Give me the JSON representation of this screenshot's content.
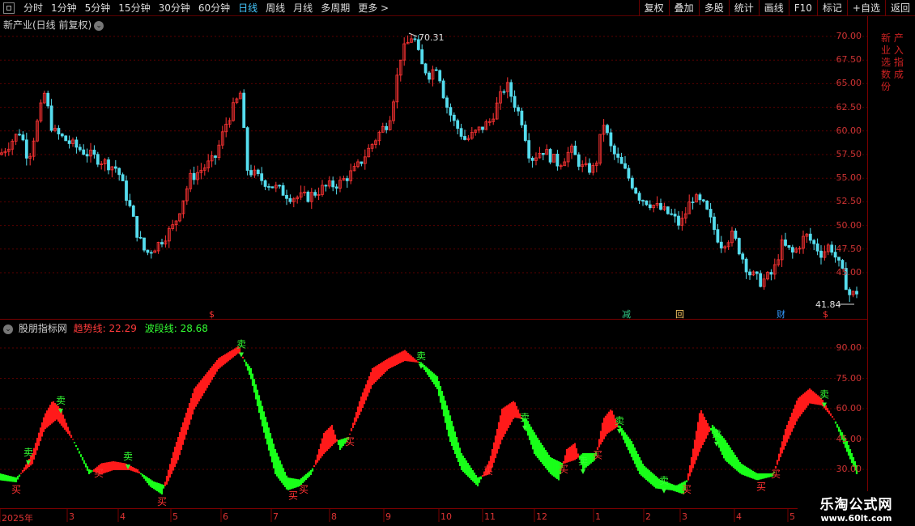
{
  "toolbar": {
    "periods": [
      "分时",
      "1分钟",
      "5分钟",
      "15分钟",
      "30分钟",
      "60分钟",
      "日线",
      "周线",
      "月线",
      "多周期",
      "更多 >"
    ],
    "active_period": "日线",
    "tools": [
      "复权",
      "叠加",
      "多股",
      "统计",
      "画线",
      "F10",
      "标记",
      "+自选",
      "返回"
    ]
  },
  "main_chart": {
    "title": "新产业(日线 前复权)",
    "y_ticks": [
      "70.00",
      "67.50",
      "65.00",
      "62.50",
      "60.00",
      "57.50",
      "55.00",
      "52.50",
      "50.00",
      "47.50",
      "45.00"
    ],
    "high_label": "70.31",
    "low_label": "41.84",
    "markers": [
      {
        "text": "$",
        "color": "#ff3333",
        "x": 263
      },
      {
        "text": "减",
        "color": "#33cc88",
        "x": 773
      },
      {
        "text": "回",
        "color": "#ffcc66",
        "x": 839
      },
      {
        "text": "财",
        "color": "#3399ff",
        "x": 964
      },
      {
        "text": "$",
        "color": "#ff3333",
        "x": 1021
      }
    ],
    "right_labels": "新 产 业 入 选 指 数 成 份"
  },
  "indicator": {
    "name": "股朋指标网",
    "trend_label": "趋势线: 22.29",
    "wave_label": "波段线: 28.68",
    "y_ticks": [
      "90.00",
      "75.00",
      "60.00",
      "45.00",
      "30.00"
    ],
    "sell_label": "卖",
    "buy_label": "买"
  },
  "x_axis": {
    "labels": [
      "2025年",
      "3",
      "4",
      "5",
      "6",
      "7",
      "8",
      "9",
      "10",
      "11",
      "12",
      "1",
      "2",
      "3",
      "4",
      "5"
    ]
  },
  "watermark": {
    "line1": "乐淘公式网",
    "line2": "www.60lt.com"
  },
  "colors": {
    "up": "#ff3333",
    "down": "#55ddee",
    "trend_red": "#ff1a1a",
    "trend_green": "#19ff19",
    "grid": "#7a0000",
    "active": "#45c8ff"
  },
  "chart_data": {
    "type": "line",
    "price_anchors": [
      [
        0,
        57.5
      ],
      [
        25,
        60
      ],
      [
        35,
        57
      ],
      [
        55,
        64
      ],
      [
        65,
        60
      ],
      [
        90,
        58.5
      ],
      [
        110,
        57.5
      ],
      [
        145,
        56
      ],
      [
        160,
        52
      ],
      [
        170,
        49
      ],
      [
        180,
        47
      ],
      [
        195,
        48
      ],
      [
        215,
        50
      ],
      [
        235,
        55
      ],
      [
        265,
        57
      ],
      [
        280,
        61
      ],
      [
        297,
        64
      ],
      [
        305,
        56
      ],
      [
        320,
        55
      ],
      [
        340,
        54
      ],
      [
        360,
        53
      ],
      [
        380,
        53
      ],
      [
        400,
        54
      ],
      [
        420,
        54.5
      ],
      [
        440,
        56
      ],
      [
        455,
        58
      ],
      [
        470,
        60
      ],
      [
        480,
        61
      ],
      [
        487,
        64
      ],
      [
        495,
        68
      ],
      [
        505,
        69.5
      ],
      [
        510,
        70.3
      ],
      [
        520,
        67
      ],
      [
        530,
        66
      ],
      [
        540,
        67
      ],
      [
        550,
        63
      ],
      [
        560,
        61
      ],
      [
        575,
        59
      ],
      [
        590,
        60
      ],
      [
        605,
        61
      ],
      [
        615,
        63
      ],
      [
        625,
        65
      ],
      [
        635,
        63
      ],
      [
        645,
        61
      ],
      [
        655,
        57
      ],
      [
        670,
        58
      ],
      [
        690,
        56.5
      ],
      [
        705,
        58
      ],
      [
        720,
        56
      ],
      [
        735,
        56
      ],
      [
        745,
        61
      ],
      [
        755,
        58
      ],
      [
        770,
        56
      ],
      [
        790,
        53
      ],
      [
        810,
        52
      ],
      [
        830,
        51
      ],
      [
        840,
        50
      ],
      [
        855,
        53
      ],
      [
        870,
        52
      ],
      [
        880,
        50
      ],
      [
        890,
        48
      ],
      [
        905,
        49
      ],
      [
        915,
        47
      ],
      [
        925,
        45
      ],
      [
        940,
        44
      ],
      [
        955,
        45
      ],
      [
        965,
        48
      ],
      [
        980,
        47
      ],
      [
        995,
        49
      ],
      [
        1005,
        48
      ],
      [
        1015,
        47
      ],
      [
        1025,
        48
      ],
      [
        1040,
        45
      ],
      [
        1050,
        42.5
      ],
      [
        1058,
        43
      ]
    ],
    "trend_anchors": [
      [
        0,
        25
      ],
      [
        20,
        24
      ],
      [
        40,
        38
      ],
      [
        55,
        57
      ],
      [
        65,
        64
      ],
      [
        75,
        60
      ],
      [
        90,
        45
      ],
      [
        110,
        28
      ],
      [
        125,
        33
      ],
      [
        140,
        34
      ],
      [
        155,
        33
      ],
      [
        170,
        30
      ],
      [
        185,
        22
      ],
      [
        200,
        18
      ],
      [
        215,
        40
      ],
      [
        240,
        70
      ],
      [
        270,
        85
      ],
      [
        295,
        91
      ],
      [
        310,
        75
      ],
      [
        325,
        50
      ],
      [
        340,
        28
      ],
      [
        355,
        20
      ],
      [
        370,
        22
      ],
      [
        385,
        28
      ],
      [
        400,
        48
      ],
      [
        410,
        52
      ],
      [
        420,
        40
      ],
      [
        430,
        45
      ],
      [
        445,
        65
      ],
      [
        460,
        80
      ],
      [
        480,
        85
      ],
      [
        500,
        89
      ],
      [
        520,
        82
      ],
      [
        540,
        70
      ],
      [
        555,
        45
      ],
      [
        570,
        30
      ],
      [
        590,
        22
      ],
      [
        605,
        35
      ],
      [
        620,
        60
      ],
      [
        635,
        64
      ],
      [
        645,
        55
      ],
      [
        660,
        38
      ],
      [
        680,
        28
      ],
      [
        690,
        25
      ],
      [
        700,
        40
      ],
      [
        710,
        43
      ],
      [
        720,
        30
      ],
      [
        735,
        35
      ],
      [
        745,
        55
      ],
      [
        755,
        60
      ],
      [
        770,
        45
      ],
      [
        790,
        28
      ],
      [
        810,
        21
      ],
      [
        830,
        20
      ],
      [
        845,
        18
      ],
      [
        855,
        38
      ],
      [
        865,
        60
      ],
      [
        880,
        48
      ],
      [
        895,
        35
      ],
      [
        915,
        28
      ],
      [
        935,
        25
      ],
      [
        955,
        27
      ],
      [
        970,
        50
      ],
      [
        985,
        65
      ],
      [
        1000,
        70
      ],
      [
        1015,
        65
      ],
      [
        1030,
        55
      ],
      [
        1045,
        40
      ],
      [
        1058,
        28
      ]
    ],
    "wave_anchors": [
      [
        0,
        28
      ],
      [
        20,
        26
      ],
      [
        40,
        33
      ],
      [
        55,
        50
      ],
      [
        70,
        55
      ],
      [
        90,
        45
      ],
      [
        110,
        30
      ],
      [
        125,
        28
      ],
      [
        140,
        30
      ],
      [
        160,
        30
      ],
      [
        175,
        28
      ],
      [
        190,
        24
      ],
      [
        205,
        22
      ],
      [
        220,
        35
      ],
      [
        240,
        60
      ],
      [
        270,
        80
      ],
      [
        295,
        88
      ],
      [
        310,
        80
      ],
      [
        325,
        60
      ],
      [
        340,
        40
      ],
      [
        355,
        26
      ],
      [
        370,
        25
      ],
      [
        385,
        30
      ],
      [
        400,
        38
      ],
      [
        415,
        44
      ],
      [
        430,
        46
      ],
      [
        445,
        58
      ],
      [
        460,
        72
      ],
      [
        480,
        80
      ],
      [
        500,
        84
      ],
      [
        520,
        83
      ],
      [
        540,
        76
      ],
      [
        555,
        58
      ],
      [
        570,
        38
      ],
      [
        590,
        26
      ],
      [
        605,
        28
      ],
      [
        620,
        45
      ],
      [
        635,
        56
      ],
      [
        650,
        55
      ],
      [
        665,
        45
      ],
      [
        680,
        36
      ],
      [
        695,
        33
      ],
      [
        710,
        35
      ],
      [
        720,
        38
      ],
      [
        735,
        38
      ],
      [
        750,
        48
      ],
      [
        765,
        52
      ],
      [
        780,
        44
      ],
      [
        795,
        32
      ],
      [
        815,
        25
      ],
      [
        835,
        22
      ],
      [
        850,
        25
      ],
      [
        865,
        40
      ],
      [
        880,
        52
      ],
      [
        895,
        45
      ],
      [
        915,
        33
      ],
      [
        935,
        28
      ],
      [
        955,
        28
      ],
      [
        970,
        42
      ],
      [
        985,
        55
      ],
      [
        1000,
        63
      ],
      [
        1015,
        62
      ],
      [
        1030,
        55
      ],
      [
        1045,
        45
      ],
      [
        1058,
        32
      ]
    ],
    "price_ylim": [
      41.84,
      70.31
    ],
    "indicator_ylim": [
      18,
      92
    ]
  }
}
